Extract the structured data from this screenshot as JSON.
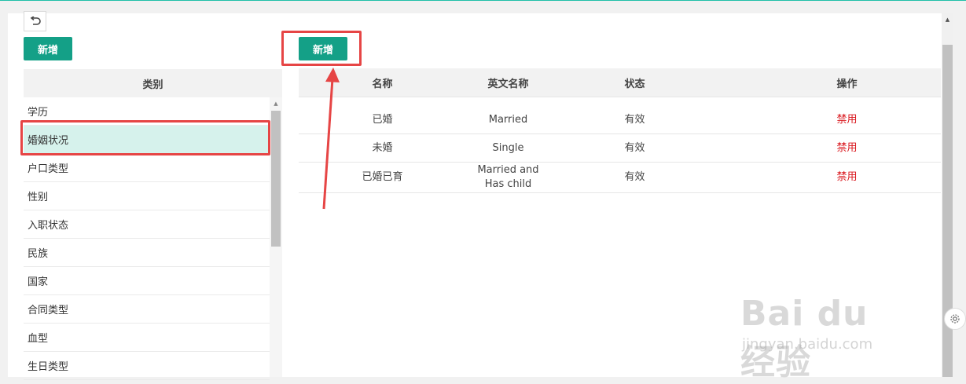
{
  "toolbar": {
    "back_icon": "undo-icon",
    "left_add_label": "新增",
    "right_add_label": "新增"
  },
  "category_panel": {
    "header": "类别",
    "items": [
      {
        "label": "学历"
      },
      {
        "label": "婚姻状况",
        "selected": true
      },
      {
        "label": "户口类型"
      },
      {
        "label": "性别"
      },
      {
        "label": "入职状态"
      },
      {
        "label": "民族"
      },
      {
        "label": "国家"
      },
      {
        "label": "合同类型"
      },
      {
        "label": "血型"
      },
      {
        "label": "生日类型"
      }
    ]
  },
  "detail_table": {
    "headers": {
      "name": "名称",
      "en_name": "英文名称",
      "status": "状态",
      "operation": "操作"
    },
    "rows": [
      {
        "name": "已婚",
        "en_name": "Married",
        "status": "有效",
        "operation": "禁用"
      },
      {
        "name": "未婚",
        "en_name": "Single",
        "status": "有效",
        "operation": "禁用"
      },
      {
        "name": "已婚已育",
        "en_name_line1": "Married and",
        "en_name_line2": "Has child",
        "status": "有效",
        "operation": "禁用"
      }
    ]
  },
  "watermark": {
    "logo": "Bai du 经验",
    "url": "jingyan.baidu.com"
  },
  "colors": {
    "primary": "#14a087",
    "annotation": "#e64545",
    "danger_text": "#d9161c",
    "selected_row": "#d6f2ec"
  },
  "icons": {
    "settings": "gear-icon"
  }
}
